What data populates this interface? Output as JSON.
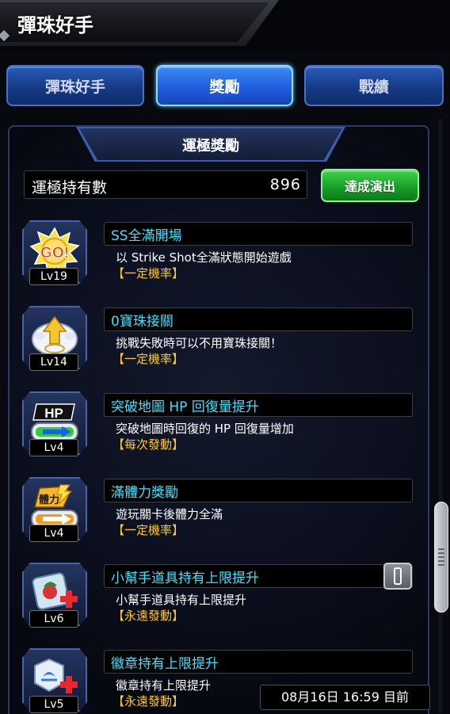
{
  "title": "彈珠好手",
  "tabs": [
    {
      "label": "彈珠好手",
      "active": false
    },
    {
      "label": "獎勵",
      "active": true
    },
    {
      "label": "戰績",
      "active": false
    }
  ],
  "section": {
    "title": "運極獎勵"
  },
  "luck": {
    "label": "運極持有數",
    "value": "896",
    "button_label": "達成演出"
  },
  "rewards": [
    {
      "level": "Lv19",
      "name": "SS全滿開場",
      "desc": "以 Strike Shot全滿狀態開始遊戲",
      "rate": "【一定機率】",
      "icon": "go-burst-icon",
      "has_info": false
    },
    {
      "level": "Lv14",
      "name": "0寶珠接關",
      "desc": "挑戰失敗時可以不用寶珠接關！",
      "rate": "【一定機率】",
      "icon": "winged-arrow-icon",
      "has_info": false
    },
    {
      "level": "Lv4",
      "name": "突破地圖 HP 回復量提升",
      "desc": "突破地圖時回復的 HP 回復量增加",
      "rate": "【每次發動】",
      "icon": "hp-gauge-icon",
      "has_info": false
    },
    {
      "level": "Lv4",
      "name": "滿體力獎勵",
      "desc": "遊玩關卡後體力全滿",
      "rate": "【一定機率】",
      "icon": "stamina-gauge-icon",
      "has_info": false
    },
    {
      "level": "Lv6",
      "name": "小幫手道具持有上限提升",
      "desc": "小幫手道具持有上限提升",
      "rate": "【永遠發動】",
      "icon": "helper-item-plus-icon",
      "has_info": true
    },
    {
      "level": "Lv5",
      "name": "徽章持有上限提升",
      "desc": "徽章持有上限提升",
      "rate": "【永遠發動】",
      "icon": "badge-plus-icon",
      "has_info": false
    }
  ],
  "datetime": "08月16日 16:59 目前",
  "colors": {
    "accent_blue": "#1f5ee0",
    "name_cyan": "#3fe0ff",
    "rate_yellow": "#ffc72a",
    "green_button": "#169c25"
  }
}
